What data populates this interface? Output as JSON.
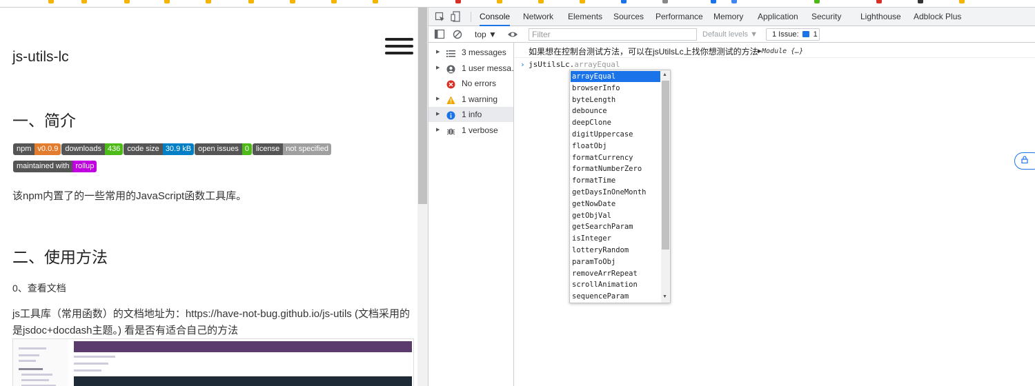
{
  "page": {
    "site_title": "js-utils-lc",
    "section1_heading": "一、简介",
    "badges": [
      {
        "label": "npm",
        "value": "v0.0.9",
        "color": "#e37c2d"
      },
      {
        "label": "downloads",
        "value": "436",
        "color": "#4cbb17"
      },
      {
        "label": "code size",
        "value": "30.9 kB",
        "color": "#007ec6"
      },
      {
        "label": "open issues",
        "value": "0",
        "color": "#4cbb17"
      },
      {
        "label": "license",
        "value": "not specified",
        "color": "#9f9f9f"
      },
      {
        "label": "maintained with",
        "value": "rollup",
        "color": "#c000e0"
      }
    ],
    "intro_text": "该npm内置了的一些常用的JavaScript函数工具库。",
    "section2_heading": "二、使用方法",
    "step0_text": "0、查看文档",
    "doc_text_line1": "js工具库（常用函数）的文档地址为：https://have-not-bug.github.io/js-utils (文档采用的",
    "doc_text_line2": "是jsdoc+docdash主题。) 看是否有适合自己的方法"
  },
  "devtools": {
    "tabs": [
      "Console",
      "Network",
      "Elements",
      "Sources",
      "Performance",
      "Memory",
      "Application",
      "Security",
      "Lighthouse",
      "Adblock Plus"
    ],
    "active_tab": "Console",
    "toolbar": {
      "context": "top ▼",
      "filter_placeholder": "Filter",
      "levels": "Default levels ▼",
      "issues": "1 Issue:",
      "issues_count": "1"
    },
    "sidebar": [
      {
        "label": "3 messages",
        "icon": "list-icon"
      },
      {
        "label": "1 user messa…",
        "icon": "user-icon"
      },
      {
        "label": "No errors",
        "icon": "error-icon"
      },
      {
        "label": "1 warning",
        "icon": "warning-icon"
      },
      {
        "label": "1 info",
        "icon": "info-icon"
      },
      {
        "label": "1 verbose",
        "icon": "bug-icon"
      }
    ],
    "console": {
      "log_message": "如果想在控制台测试方法，可以在jsUtilsLc上找你想测试的方法",
      "log_object": "▶Module {…}",
      "input_typed": "jsUtilsLc.",
      "input_ghost": "arrayEqual",
      "autocomplete": [
        "arrayEqual",
        "browserInfo",
        "byteLength",
        "debounce",
        "deepClone",
        "digitUppercase",
        "floatObj",
        "formatCurrency",
        "formatNumberZero",
        "formatTime",
        "getDaysInOneMonth",
        "getNowDate",
        "getObjVal",
        "getSearchParam",
        "isInteger",
        "lotteryRandom",
        "paramToObj",
        "removeArrRepeat",
        "scrollAnimation",
        "sequenceParam"
      ],
      "autocomplete_selected": "arrayEqual"
    }
  },
  "right_pill": "",
  "colors": {
    "accent": "#1a73e8",
    "warning": "#f2a600",
    "error": "#d93025"
  }
}
